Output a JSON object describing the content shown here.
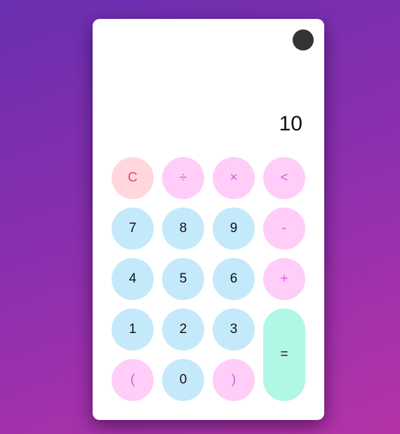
{
  "display": {
    "value": "10"
  },
  "colors": {
    "number_bg": "#c4e9fb",
    "operator_bg": "#ffcdf8",
    "operator_text": "#d75ed9",
    "clear_bg": "#ffd7dd",
    "clear_text": "#f0455e",
    "equals_bg": "#b1f7e5",
    "toggle": "#333333"
  },
  "theme_toggle": {
    "icon": "dark-circle-icon"
  },
  "buttons": {
    "clear": "C",
    "divide": "÷",
    "multiply": "×",
    "backspace": "<",
    "seven": "7",
    "eight": "8",
    "nine": "9",
    "minus": "-",
    "four": "4",
    "five": "5",
    "six": "6",
    "plus": "+",
    "one": "1",
    "two": "2",
    "three": "3",
    "equals": "=",
    "open_paren": "(",
    "zero": "0",
    "close_paren": ")"
  }
}
